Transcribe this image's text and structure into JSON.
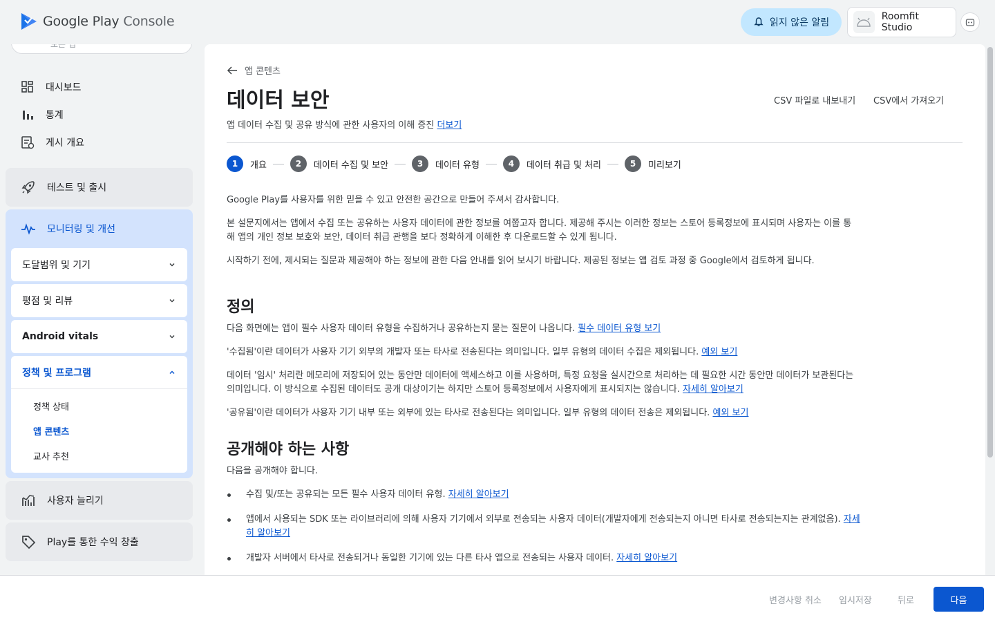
{
  "header": {
    "logo_text_a": "Google Play",
    "logo_text_b": "Console",
    "notifications_label": "읽지 않은 알림",
    "account_name": "Roomfit Studio",
    "icons": {
      "logo": "play-console-logo",
      "notifications": "bell-icon",
      "account": "android-icon",
      "help": "help-icon"
    }
  },
  "sidebar": {
    "search_stub": "모든 앱",
    "items": [
      {
        "label": "대시보드",
        "icon": "dashboard-icon"
      },
      {
        "label": "통계",
        "icon": "bar-chart-icon"
      },
      {
        "label": "게시 개요",
        "icon": "publishing-icon"
      }
    ],
    "groups": {
      "testing": {
        "label": "테스트 및 출시",
        "icon": "rocket-icon"
      },
      "monitor": {
        "label": "모니터링 및 개선",
        "icon": "pulse-icon",
        "cards": [
          {
            "label": "도달범위 및 기기"
          },
          {
            "label": "평점 및 리뷰"
          },
          {
            "label": "Android vitals"
          },
          {
            "label": "정책 및 프로그램",
            "children": [
              "정책 상태",
              "앱 콘텐츠",
              "교사 추천"
            ]
          }
        ]
      },
      "grow": {
        "label": "사용자 늘리기",
        "icon": "growth-chart-icon"
      },
      "monetize": {
        "label": "Play를 통한 수익 창출",
        "icon": "tag-icon"
      }
    }
  },
  "main": {
    "back_label": "앱 콘텐츠",
    "title": "데이터 보안",
    "subtitle": "앱 데이터 수집 및 공유 방식에 관한 사용자의 이해 증진",
    "subtitle_link": "더보기",
    "export_csv": "CSV 파일로 내보내기",
    "import_csv": "CSV에서 가져오기",
    "steps": [
      {
        "num": "1",
        "label": "개요"
      },
      {
        "num": "2",
        "label": "데이터 수집 및 보안"
      },
      {
        "num": "3",
        "label": "데이터 유형"
      },
      {
        "num": "4",
        "label": "데이터 취급 및 처리"
      },
      {
        "num": "5",
        "label": "미리보기"
      }
    ],
    "intro": [
      "Google Play를 사용자를 위한 믿을 수 있고 안전한 공간으로 만들어 주셔서 감사합니다.",
      "본 설문지에서는 앱에서 수집 또는 공유하는 사용자 데이터에 관한 정보를 여쭙고자 합니다. 제공해 주시는 이러한 정보는 스토어 등록정보에 표시되며 사용자는 이를 통해 앱의 개인 정보 보호와 보안, 데이터 취급 관행을 보다 정확하게 이해한 후 다운로드할 수 있게 됩니다.",
      "시작하기 전에, 제시되는 질문과 제공해야 하는 정보에 관한 다음 안내를 읽어 보시기 바랍니다. 제공된 정보는 앱 검토 과정 중 Google에서 검토하게 됩니다."
    ],
    "definitions_heading": "정의",
    "definitions": [
      {
        "text": "다음 화면에는 앱이 필수 사용자 데이터 유형을 수집하거나 공유하는지 묻는 질문이 나옵니다. ",
        "link": "필수 데이터 유형 보기"
      },
      {
        "text": "'수집됨'이란 데이터가 사용자 기기 외부의 개발자 또는 타사로 전송된다는 의미입니다. 일부 유형의 데이터 수집은 제외됩니다. ",
        "link": "예외 보기"
      },
      {
        "text": "데이터 '임시' 처리란 메모리에 저장되어 있는 동안만 데이터에 액세스하고 이를 사용하며, 특정 요청을 실시간으로 처리하는 데 필요한 시간 동안만 데이터가 보관된다는 의미입니다. 이 방식으로 수집된 데이터도 공개 대상이기는 하지만 스토어 등록정보에서 사용자에게 표시되지는 않습니다. ",
        "link": "자세히 알아보기"
      },
      {
        "text": "'공유됨'이란 데이터가 사용자 기기 내부 또는 외부에 있는 타사로 전송된다는 의미입니다. 일부 유형의 데이터 전송은 제외됩니다. ",
        "link": "예외 보기"
      }
    ],
    "disclose_heading": "공개해야 하는 사항",
    "disclose_intro": "다음을 공개해야 합니다.",
    "bullets": [
      {
        "text": "수집 및/또는 공유되는 모든 필수 사용자 데이터 유형. ",
        "link": "자세히 알아보기"
      },
      {
        "text": "앱에서 사용되는 SDK 또는 라이브러리에 의해 사용자 기기에서 외부로 전송되는 사용자 데이터(개발자에게 전송되는지 아니면 타사로 전송되는지는 관계없음). ",
        "link": "자세히 알아보기"
      },
      {
        "text": "개발자 서버에서 타사로 전송되거나 동일한 기기에 있는 다른 타사 앱으로 전송되는 사용자 데이터. ",
        "link": "자세히 알아보기"
      }
    ]
  },
  "footer": {
    "discard": "변경사항 취소",
    "save_draft": "임시저장",
    "back": "뒤로",
    "next": "다음"
  },
  "colors": {
    "accent": "#0b57d0",
    "active_group_bg": "#d3e3fd",
    "notif_bg": "#c2e7ff"
  }
}
